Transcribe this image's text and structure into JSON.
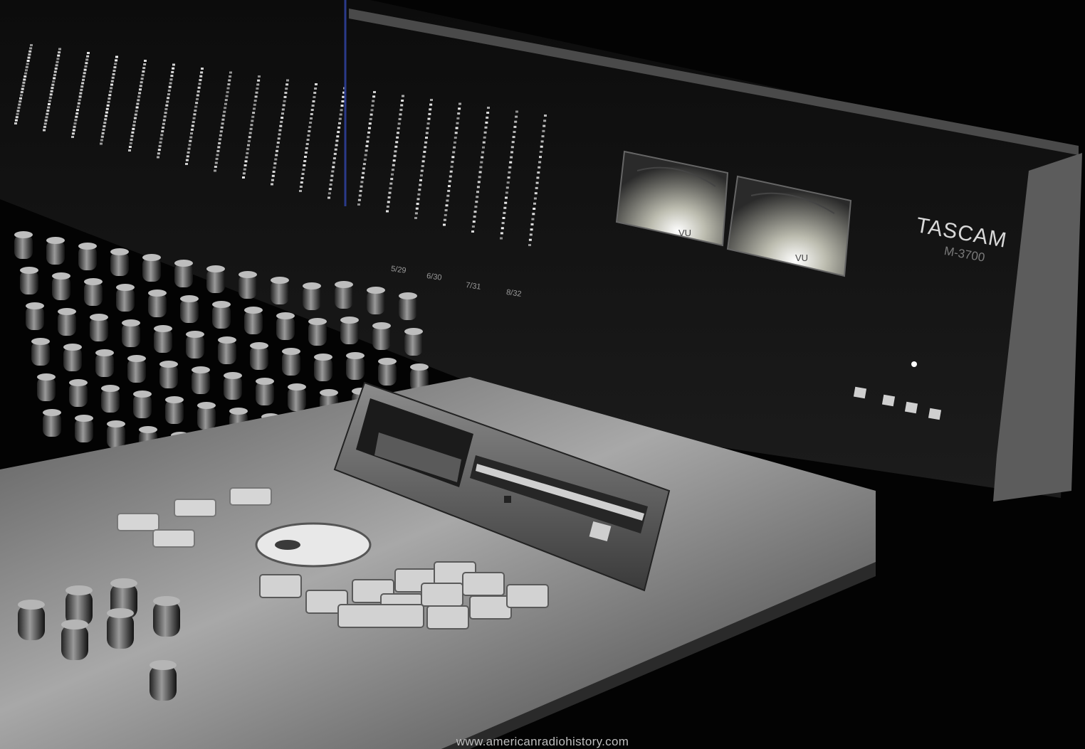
{
  "meter_bridge": {
    "brand": "TASCAM",
    "model": "M-3700",
    "vu_label": "VU",
    "channel_labels": [
      "5/29",
      "6/30",
      "7/31",
      "8/32"
    ]
  },
  "footer": {
    "watermark": "www.americanradiohistory.com"
  },
  "colors": {
    "background": "#000000",
    "console_panel": "#8a8a8a",
    "led_lit": "#f2f2f2",
    "vu_glow": "#e6e6d8"
  }
}
